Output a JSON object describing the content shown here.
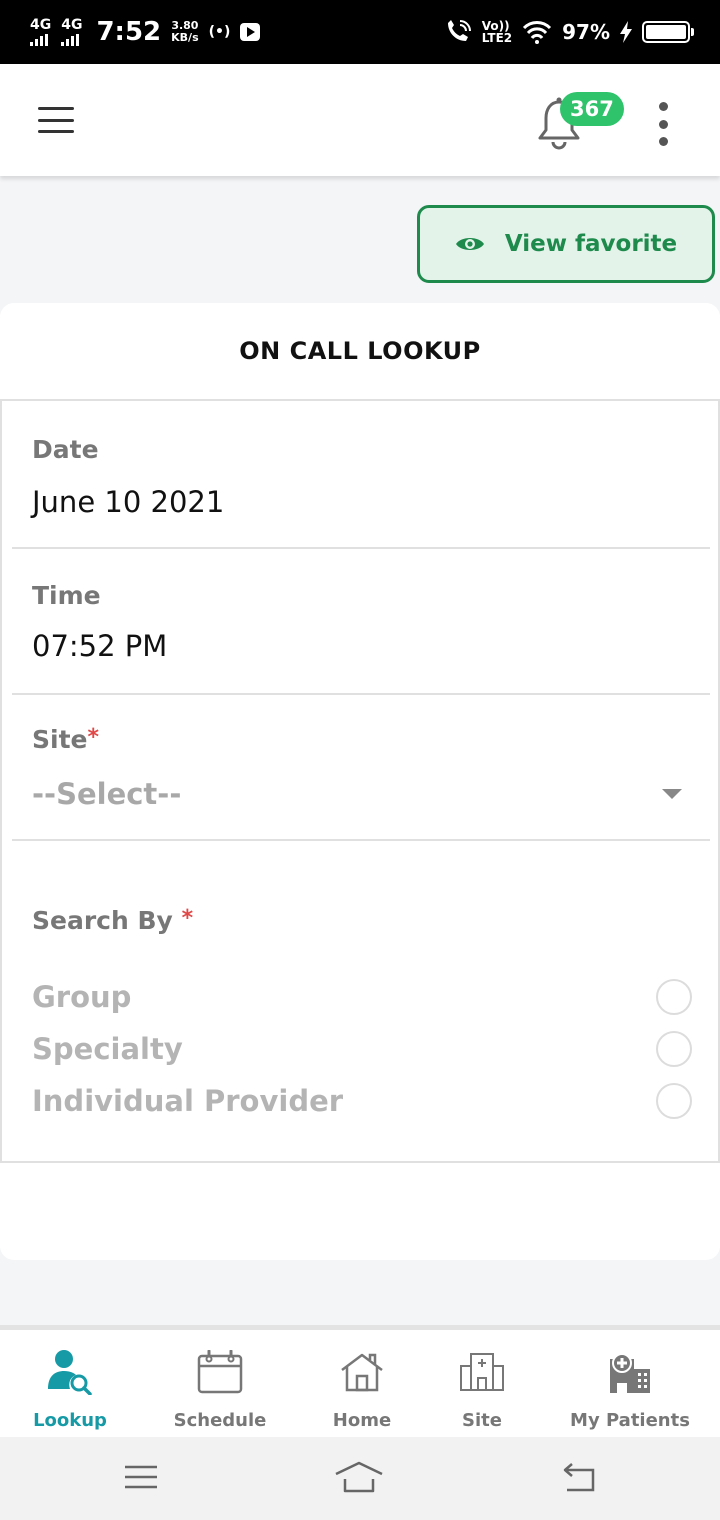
{
  "status_bar": {
    "net1": "4G",
    "net2": "4G",
    "time": "7:52",
    "speed_value": "3.80",
    "speed_unit": "KB/s",
    "hotspot": "(•)",
    "lte_top": "Vo))",
    "lte_bottom": "LTE2",
    "battery": "97%"
  },
  "header": {
    "notification_count": "367"
  },
  "favorite": {
    "label": "View favorite"
  },
  "card": {
    "title": "ON CALL LOOKUP",
    "date": {
      "label": "Date",
      "value": "June 10 2021"
    },
    "time": {
      "label": "Time",
      "value": "07:52 PM"
    },
    "site": {
      "label": "Site",
      "required": "*",
      "placeholder": "--Select--"
    },
    "search_by": {
      "label": "Search By",
      "required": "*",
      "options": [
        "Group",
        "Specialty",
        "Individual Provider"
      ]
    }
  },
  "bottom_nav": {
    "items": [
      {
        "label": "Lookup",
        "icon": "lookup-icon",
        "active": true
      },
      {
        "label": "Schedule",
        "icon": "calendar-icon",
        "active": false
      },
      {
        "label": "Home",
        "icon": "home-icon",
        "active": false
      },
      {
        "label": "Site",
        "icon": "building-icon",
        "active": false
      },
      {
        "label": "My Patients",
        "icon": "hospital-icon",
        "active": false
      }
    ]
  },
  "colors": {
    "accent_green": "#1e8a4c",
    "badge_green": "#2fc36b",
    "active_teal": "#169aa6",
    "required_red": "#e04848"
  }
}
